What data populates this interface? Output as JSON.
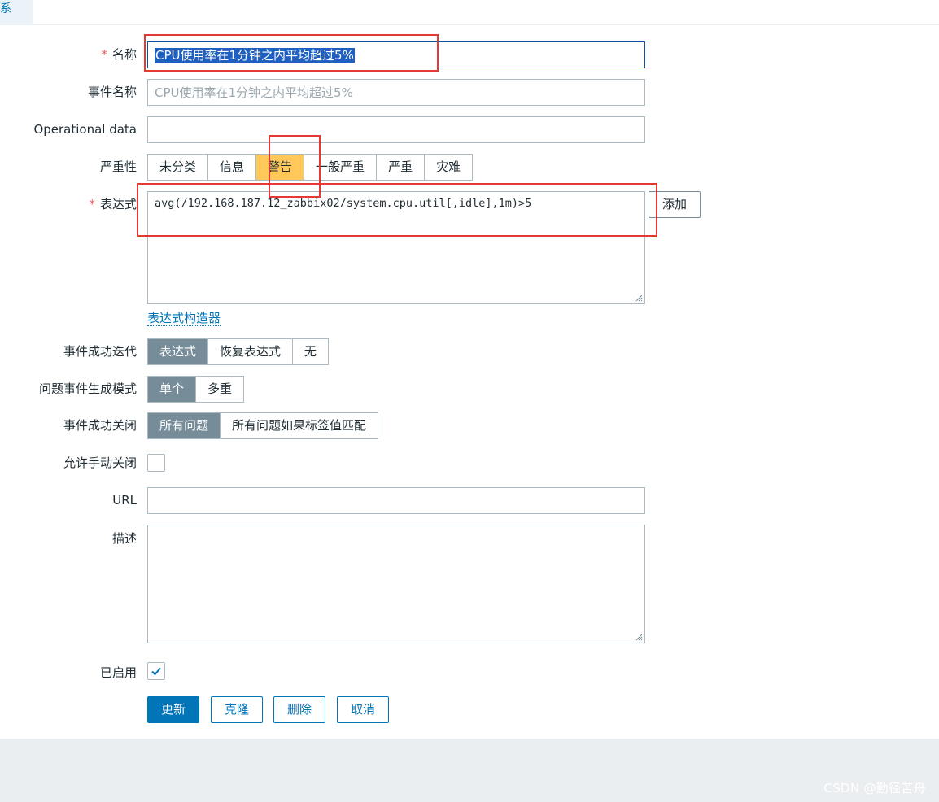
{
  "tab": {
    "label": "关系"
  },
  "form": {
    "name": {
      "label": "名称",
      "value": "CPU使用率在1分钟之内平均超过5%"
    },
    "event_name": {
      "label": "事件名称",
      "placeholder": "CPU使用率在1分钟之内平均超过5%"
    },
    "operational_data": {
      "label": "Operational data",
      "value": ""
    },
    "severity": {
      "label": "严重性",
      "options": [
        "未分类",
        "信息",
        "警告",
        "一般严重",
        "严重",
        "灾难"
      ],
      "selected": "警告"
    },
    "expression": {
      "label": "表达式",
      "value": "avg(/192.168.187.12_zabbix02/system.cpu.util[,idle],1m)>5",
      "add_button": "添加",
      "constructor_link": "表达式构造器"
    },
    "ok_event_generation": {
      "label": "事件成功迭代",
      "options": [
        "表达式",
        "恢复表达式",
        "无"
      ],
      "selected": "表达式"
    },
    "problem_mode": {
      "label": "问题事件生成模式",
      "options": [
        "单个",
        "多重"
      ],
      "selected": "单个"
    },
    "ok_event_closes": {
      "label": "事件成功关闭",
      "options": [
        "所有问题",
        "所有问题如果标签值匹配"
      ],
      "selected": "所有问题"
    },
    "manual_close": {
      "label": "允许手动关闭",
      "checked": false
    },
    "url": {
      "label": "URL",
      "value": ""
    },
    "description": {
      "label": "描述",
      "value": ""
    },
    "enabled": {
      "label": "已启用",
      "checked": true
    }
  },
  "actions": {
    "update": "更新",
    "clone": "克隆",
    "delete": "删除",
    "cancel": "取消"
  },
  "watermark": "CSDN @勤径苦舟",
  "colors": {
    "accent": "#0275b8",
    "warning": "#ffc859",
    "segment_selected": "#768d99",
    "annotation": "#e53935"
  }
}
